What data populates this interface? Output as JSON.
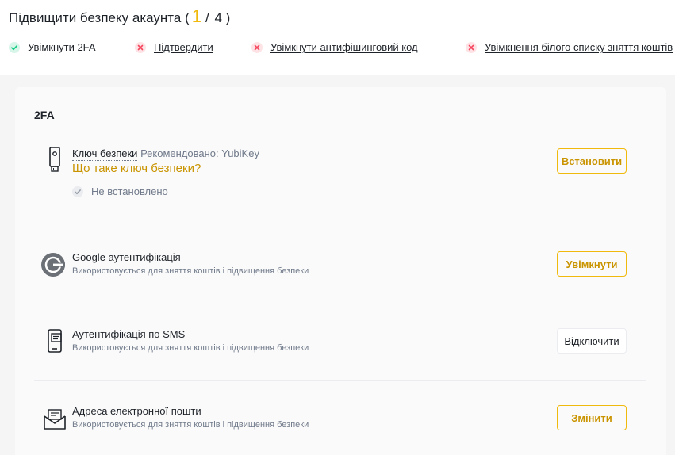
{
  "header": {
    "title": "Підвищити безпеку акаунта",
    "progress_open": "(",
    "progress_current": "1",
    "progress_sep": "/",
    "progress_total": "4",
    "progress_close": ")"
  },
  "steps": [
    {
      "label": "Увімкнути 2FA",
      "done": true
    },
    {
      "label": "Підтвердити",
      "done": false
    },
    {
      "label": "Увімкнути антифішинговий код",
      "done": false
    },
    {
      "label": "Увімкнення білого списку зняття коштів",
      "done": false
    }
  ],
  "colors": {
    "accent": "#f0b90b",
    "accent_text": "#c99400",
    "success": "#0ecb81",
    "error": "#f6465d"
  },
  "section": {
    "title": "2FA",
    "items": [
      {
        "icon": "security-key-icon",
        "name": "Ключ безпеки",
        "recommended": "Рекомендовано: YubiKey",
        "link": "Що таке ключ безпеки?",
        "status": "Не встановлено",
        "button": "Встановити"
      },
      {
        "icon": "google-authenticator-icon",
        "name": "Google аутентифікація",
        "description": "Використовується для зняття коштів і підвищення безпеки",
        "button": "Увімкнути"
      },
      {
        "icon": "sms-phone-icon",
        "name": "Аутентифікація по SMS",
        "description": "Використовується для зняття коштів і підвищення безпеки",
        "button": "Відключити"
      },
      {
        "icon": "email-envelope-icon",
        "name": "Адреса електронної пошти",
        "description": "Використовується для зняття коштів і підвищення безпеки",
        "button": "Змінити"
      }
    ]
  }
}
